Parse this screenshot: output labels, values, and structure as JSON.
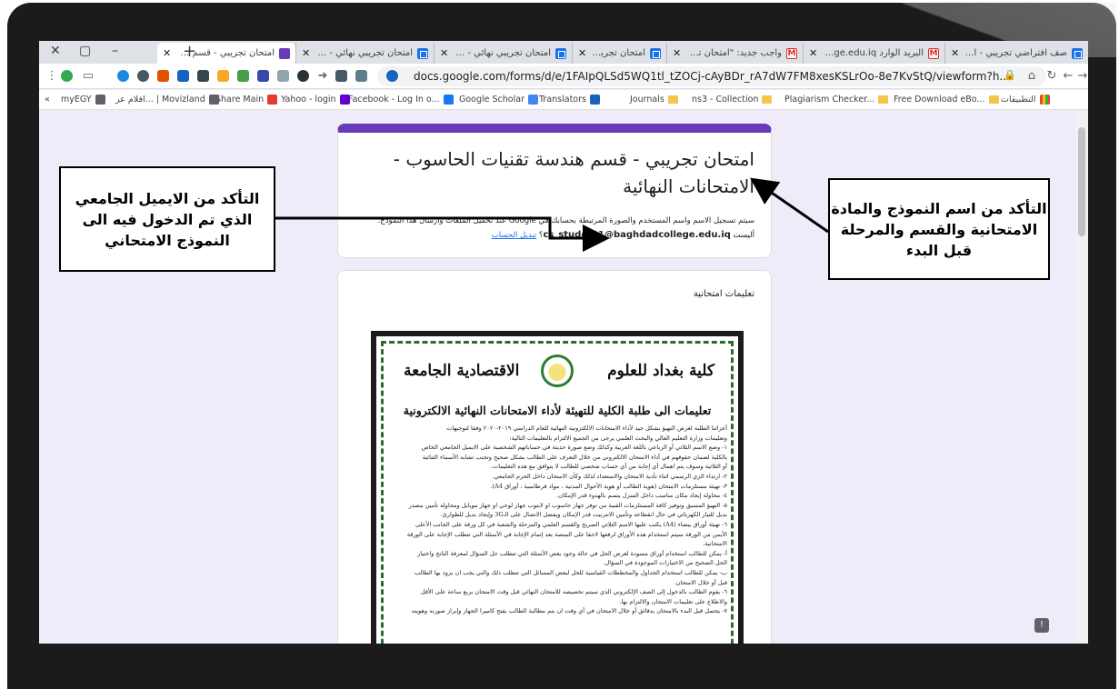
{
  "browser": {
    "tabs": [
      {
        "title": "صف افتراضي تجريبي - امتحان",
        "icon": "forms",
        "active": false
      },
      {
        "title": "البريد الوارد Dadcollege.edu.iq",
        "icon": "gmail",
        "active": false
      },
      {
        "title": "واجب جديد: \"امتحان تجريبي نها",
        "icon": "gmail",
        "active": false
      },
      {
        "title": "امتحان تجريبي نها",
        "icon": "forms",
        "active": false
      },
      {
        "title": "امتحان تجريبي نهائي - قسم هـ",
        "icon": "forms",
        "active": false
      },
      {
        "title": "امتحان تجريبي نهائي - قسم هـ",
        "icon": "forms",
        "active": false
      },
      {
        "title": "امتحان تجريبي - قسم هندسة ت",
        "icon": "purple",
        "active": true
      }
    ],
    "new_tab_label": "+",
    "window_controls": {
      "minimize": "–",
      "maximize": "▢",
      "close": "✕"
    },
    "url": "docs.google.com/forms/d/e/1FAIpQLSd5WQ1tl_tZOCj-cAyBDr_rA7dW7FM8xesKSLrOo-8e7KvStQ/viewform?h...",
    "bookmarks": [
      {
        "label": "التطبيقات",
        "type": "apps"
      },
      {
        "label": "Free Download eBo...",
        "type": "folder"
      },
      {
        "label": "Plagiarism Checker...",
        "type": "folder"
      },
      {
        "label": "ns3 - Collection",
        "type": "folder"
      },
      {
        "label": "Journals",
        "type": "folder"
      },
      {
        "label": "Translators",
        "type": "site"
      },
      {
        "label": "Google Scholar",
        "type": "site"
      },
      {
        "label": "Facebook - Log In o...",
        "type": "site"
      },
      {
        "label": "Yahoo - login",
        "type": "site"
      },
      {
        "label": "Share Main",
        "type": "site"
      },
      {
        "label": "افلام عر... | Movizland",
        "type": "site"
      },
      {
        "label": "myEGY",
        "type": "site"
      }
    ],
    "bookmarks_more": "«"
  },
  "form": {
    "title": "امتحان تجريبي - قسم هندسة تقنيات الحاسوب - الامتحانات النهائية",
    "note_prefix": "سيتم تسجيل الاسم واسم المستخدم والصورة المرتبطة بحسابك في Google عند تحميل الملفات وارسال هذا النموذج. أليست",
    "email": "cs_student1@baghdadcollege.edu.iq",
    "note_suffix": "؟",
    "switch_account": "تبديل الحساب",
    "description_label": "تعليمات امتحانية"
  },
  "document_image": {
    "college_name": "كلية بغداد للعلوم",
    "college_type": "الاقتصادية الجامعة",
    "heading": "تعليمات الى طلبة الكلية للتهيئة لأداء الامتحانات النهائية الالكترونية",
    "lines": [
      "أعزائنا الطلبة لغرض التهيؤ بشكل جيد لأداء الامتحانات الالكترونية النهائية للعام الدراسي ٢٠١٩-٢٠٢٠ وفقا لتوجيهات",
      "وتعليمات وزارة التعليم العالي والبحث العلمي يرجى من الجميع الالتزام بالتعليمات التالية:",
      "١- وضع الاسم الثلاثي أو الرباعي باللغة العربية وكذلك وضع صورة حديثة في حساباتهم الشخصية على الايميل الجامعي الخاص",
      "بالكلية لضمان حقوقهم في أداء الامتحان الالكتروني من خلال التعرف على الطالب بشكل صحيح وتجنب تشابه الأسماء الثنائية",
      "أو الثلاثية وسوف يتم اهمال أي إجابة من أي حساب شخصي للطالب لا يتوافق مع هذه التعليمات.",
      "٢- ارتداء الزي الرسمي اثناء تأدية الامتحان والاستعداد لذلك وكأن الامتحان داخل الحرم الجامعي.",
      "٣- تهيئة مستلزمات الامتحان (هوية الطالب أو هوية الأحوال المدنية ، مواد قرطاسية ، أوراق A4).",
      "٤- محاولة إيجاد مكان مناسب داخل المنزل يتسم بالهدوء قدر الإمكان.",
      "٥- التهيؤ المسبق وتوفير كافة المستلزمات الفنية من توفر جهاز حاسوب او لابتوب جهاز لوحي او جهاز موبايل ومحاولة تأمين مصدر",
      "بديل للتيار الكهربائي في حال انقطاعه وتأمين الانترنيت قدر الإمكان ويفضل الاتصال على الـ3G وإيجاد بديل للطوارئ.",
      "٦- تهيئة أوراق بيضاء (A4) يكتب عليها الاسم الثلاثي الصريح والقسم العلمي والمرحلة والشعبة في كل ورقة على الجانب الأعلى",
      "الأيمن من الورقة سيتم استخدام هذه الأوراق لرفعها لاحقا على المنصة بعد إتمام الإجابة في الأسئلة التي تتطلب الإجابة على الورقة",
      "الامتحانية.",
      "أ- يمكن للطالب استخدام أوراق مسودة لغرض الحل في حالة وجود بعض الأسئلة التي تتطلب حل السؤال لمعرفة الناتج واختيار",
      "الحل الصحيح من الاختيارات الموجودة في السؤال.",
      "ب- يمكن للطالب استخدام الجداول والمخططات القياسية للحل لبعض المسائل التي تتطلب ذلك والتي يجب ان يزود بها الطالب",
      "قبل أو خلال الامتحان.",
      "٦- يقوم الطالب بالدخول إلى الصف الإلكتروني الذي سيتم تخصيصه للامتحان النهائي قبل وقت الامتحان بربع ساعة على الأقل",
      "والاطلاع على تعليمات الامتحان والالتزام بها.",
      "٧- يحتمل قبل البدء بالامتحان بدقائق أو خلال الامتحان في أي وقت ان يتم مطالبة الطالب بفتح كاميرا الجهاز وإبراز صورته وهويته"
    ]
  },
  "callouts": {
    "left": "التأكد من الايميل الجامعي الذي تم الدخول فيه الى النموذج الامتحاني",
    "right": "التأكد من اسم النموذج والمادة الامتحانية والقسم والمرحلة قبل البدء"
  },
  "colors": {
    "form_accent": "#673ab7",
    "page_background": "#f0ebf8",
    "link": "#1a73e8"
  }
}
